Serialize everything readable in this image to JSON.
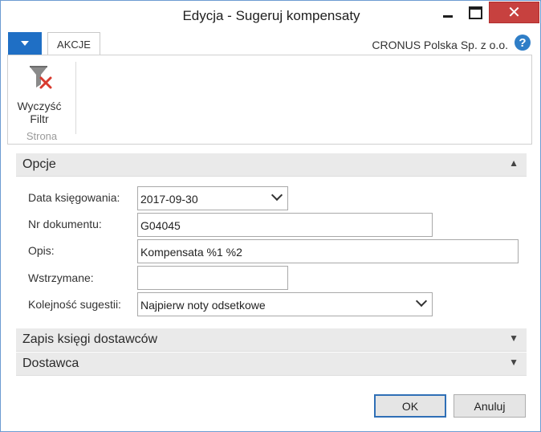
{
  "window": {
    "title": "Edycja - Sugeruj kompensaty"
  },
  "ribbon_bar": {
    "tab_label": "AKCJE",
    "company": "CRONUS Polska Sp. z o.o.",
    "help": "?"
  },
  "ribbon": {
    "clear_filter_line1": "Wyczyść",
    "clear_filter_line2": "Filtr",
    "group_label": "Strona"
  },
  "options": {
    "section_title": "Opcje",
    "fields": {
      "posting_date_label": "Data księgowania:",
      "posting_date_value": "2017-09-30",
      "document_no_label": "Nr dokumentu:",
      "document_no_value": "G04045",
      "description_label": "Opis:",
      "description_value": "Kompensata %1 %2",
      "on_hold_label": "Wstrzymane:",
      "on_hold_value": "",
      "suggestion_order_label": "Kolejność sugestii:",
      "suggestion_order_value": "Najpierw noty odsetkowe"
    }
  },
  "sections": {
    "vendor_ledger": "Zapis księgi dostawców",
    "vendor": "Dostawca"
  },
  "buttons": {
    "ok": "OK",
    "cancel": "Anuluj"
  },
  "icons": {
    "menu": "menu-dropdown-icon",
    "help": "help-icon",
    "clear_filter": "clear-filter-icon",
    "collapse": "chevron-up-icon",
    "expand": "chevron-down-icon"
  },
  "colors": {
    "accent": "#1f6fc5",
    "close_button": "#c7413f",
    "fasttab_bg": "#eaeaea"
  }
}
